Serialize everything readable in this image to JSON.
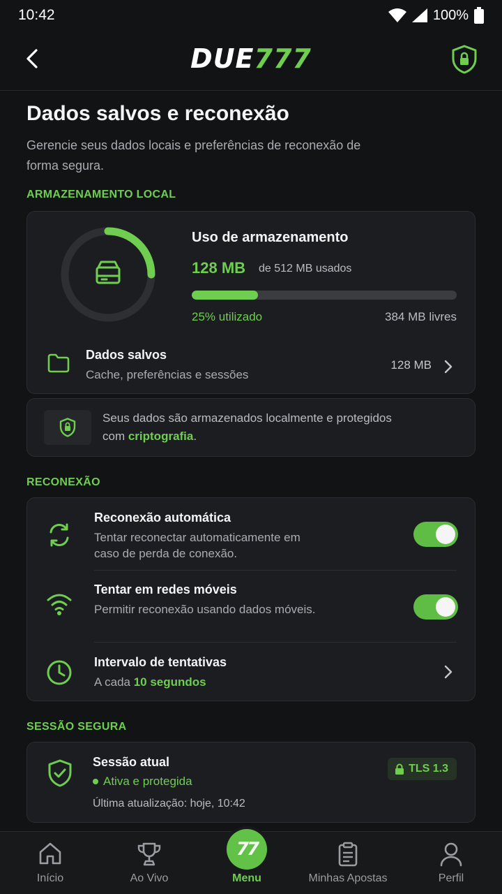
{
  "status_bar": {
    "time": "10:42",
    "battery": "100%"
  },
  "header": {
    "logo_main": "DUE",
    "logo_accent": "777"
  },
  "page": {
    "title": "Dados salvos e reconexão",
    "subtitle": "Gerencie seus dados locais e preferências de reconexão de forma segura."
  },
  "storage": {
    "section_label": "ARMAZENAMENTO LOCAL",
    "title": "Uso de armazenamento",
    "used": "128 MB",
    "of_total": "de 512 MB usados",
    "used_fraction": 0.25,
    "percent_label": "25% utilizado",
    "free_label": "384 MB livres",
    "saved_title": "Dados salvos",
    "saved_sub": "Cache, preferências e sessões",
    "saved_size": "128 MB"
  },
  "info": {
    "text": "Seus dados são armazenados localmente e protegidos com ",
    "highlight": "criptografia",
    "end": "."
  },
  "reconnect": {
    "section_label": "RECONEXÃO",
    "auto_title": "Reconexão automática",
    "auto_sub": "Tentar reconectar automaticamente em caso de perda de conexão.",
    "auto_on": true,
    "mobile_title": "Tentar em redes móveis",
    "mobile_sub": "Permitir reconexão usando dados móveis.",
    "mobile_on": true,
    "interval_title": "Intervalo de tentativas",
    "interval_prefix": "A cada ",
    "interval_value": "10 segundos"
  },
  "session": {
    "section_label": "SESSÃO SEGURA",
    "title": "Sessão atual",
    "status": "Ativa e protegida",
    "updated": "Última atualização: hoje, 10:42",
    "badge": "TLS 1.3"
  },
  "nav": {
    "home": "Início",
    "live": "Ao Vivo",
    "menu": "Menu",
    "menu_logo": "77",
    "bets": "Minhas Apostas",
    "profile": "Perfil"
  },
  "colors": {
    "accent": "#6fce50",
    "background": "#121315",
    "card": "#1c1d20"
  }
}
